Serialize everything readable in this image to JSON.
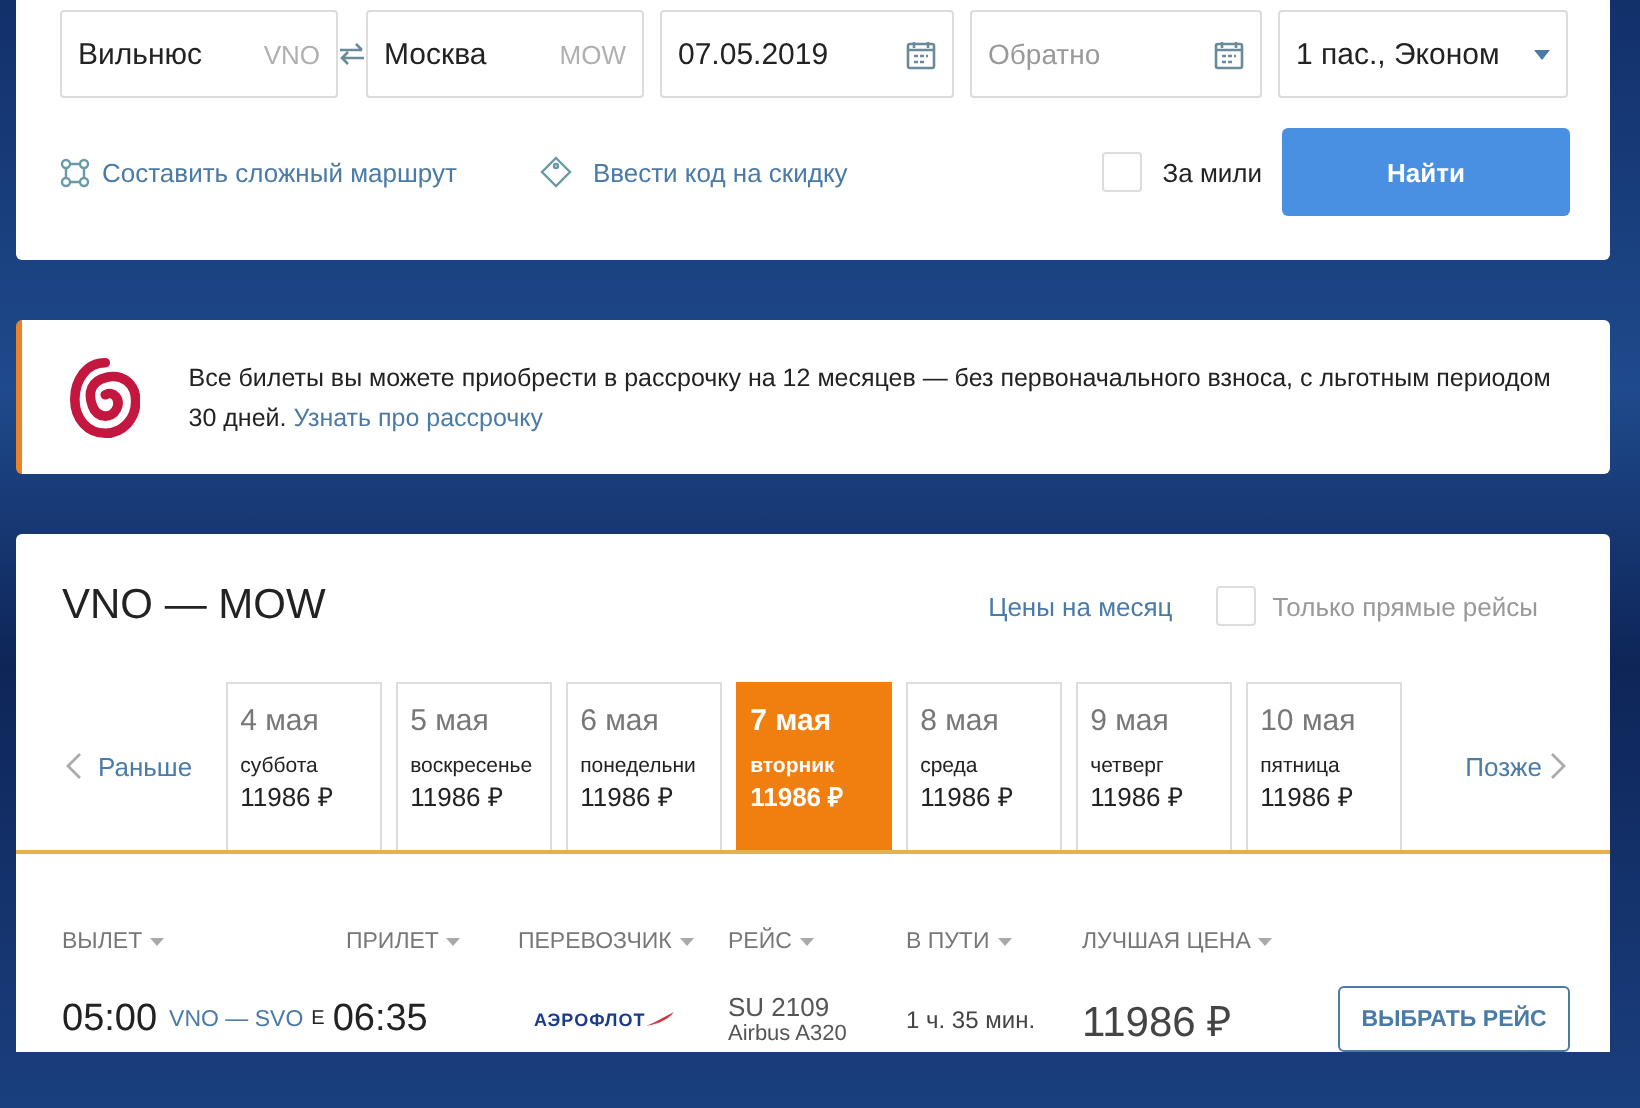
{
  "search": {
    "fields": [
      {
        "kind": "city",
        "value": "Вильнюс",
        "code": "VNO"
      },
      {
        "kind": "city",
        "value": "Москва",
        "code": "MOW"
      },
      {
        "kind": "date",
        "value": "07.05.2019"
      },
      {
        "kind": "date",
        "placeholder": "Обратно"
      },
      {
        "kind": "select",
        "value": "1 пас., Эконом"
      }
    ],
    "complex_route_link": "Составить сложный маршрут",
    "promo_link": "Ввести код на скидку",
    "miles": {
      "label": "За мили",
      "checked": false
    },
    "find_button": "Найти"
  },
  "banner": {
    "text": "Все билеты вы можете приобрести в рассрочку на 12 месяцев — без первоначального взноса, с льготным периодом 30 дней.",
    "link": "Узнать про рассрочку"
  },
  "results": {
    "title": "VNO — MOW",
    "month_prices_link": "Цены на месяц",
    "direct_only": {
      "label": "Только прямые рейсы",
      "checked": false
    },
    "earlier": "Раньше",
    "later": "Позже",
    "days": [
      {
        "date": "4 мая",
        "weekday": "суббота",
        "price": "11986 ₽",
        "selected": false
      },
      {
        "date": "5 мая",
        "weekday": "воскресенье",
        "price": "11986 ₽",
        "selected": false
      },
      {
        "date": "6 мая",
        "weekday": "понедельни",
        "price": "11986 ₽",
        "selected": false
      },
      {
        "date": "7 мая",
        "weekday": "вторник",
        "price": "11986 ₽",
        "selected": true
      },
      {
        "date": "8 мая",
        "weekday": "среда",
        "price": "11986 ₽",
        "selected": false
      },
      {
        "date": "9 мая",
        "weekday": "четверг",
        "price": "11986 ₽",
        "selected": false
      },
      {
        "date": "10 мая",
        "weekday": "пятница",
        "price": "11986 ₽",
        "selected": false
      }
    ],
    "columns": [
      "ВЫЛЕТ",
      "ПРИЛЕТ",
      "ПЕРЕВОЗЧИК",
      "РЕЙС",
      "В ПУТИ",
      "ЛУЧШАЯ ЦЕНА"
    ],
    "flights": [
      {
        "departure": "05:00",
        "route": "VNO — SVO",
        "ticket_mark": "Е",
        "arrival": "06:35",
        "carrier": "АЭРОФЛОТ",
        "flight": "SU 2109",
        "aircraft": "Airbus A320",
        "duration": "1 ч. 35 мин.",
        "price": "11986 ₽",
        "button": "ВЫБРАТЬ РЕЙС"
      }
    ]
  }
}
